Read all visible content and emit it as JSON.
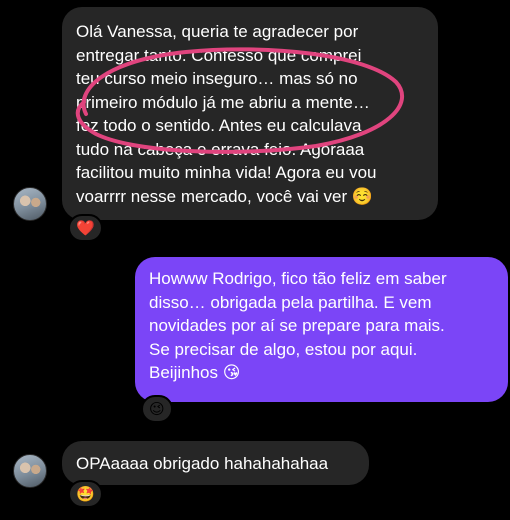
{
  "messages": [
    {
      "sender": "incoming",
      "lines": [
        "Olá Vanessa, queria te agradecer por",
        "entregar tanto. Confesso que comprei",
        "teu curso meio inseguro… mas só no",
        "primeiro módulo já me abriu a mente…",
        "fez todo o sentido. Antes eu calculava",
        "tudo na cabeça e errava feio. Agoraaa",
        "facilitou muito minha vida! Agora eu vou",
        "voarrrr nesse mercado, você vai ver ☺️"
      ],
      "reaction": "❤️",
      "reaction_icon": "red-heart-icon"
    },
    {
      "sender": "outgoing",
      "lines": [
        "Howww Rodrigo, fico tão feliz em saber",
        "disso… obrigada pela partilha. E vem",
        "novidades por aí se prepare para mais.",
        "Se precisar de algo, estou por aqui.",
        "Beijinhos 😘"
      ],
      "reaction": "😉",
      "reaction_icon": "winking-face-icon"
    },
    {
      "sender": "incoming",
      "lines": [
        "OPAaaaa obrigado hahahahahaa"
      ],
      "reaction": "🤩",
      "reaction_icon": "star-struck-face-icon"
    }
  ],
  "colors": {
    "background": "#000000",
    "incoming_bubble": "#262626",
    "outgoing_bubble": "#7b45f7",
    "annotation": "#e0447e"
  }
}
